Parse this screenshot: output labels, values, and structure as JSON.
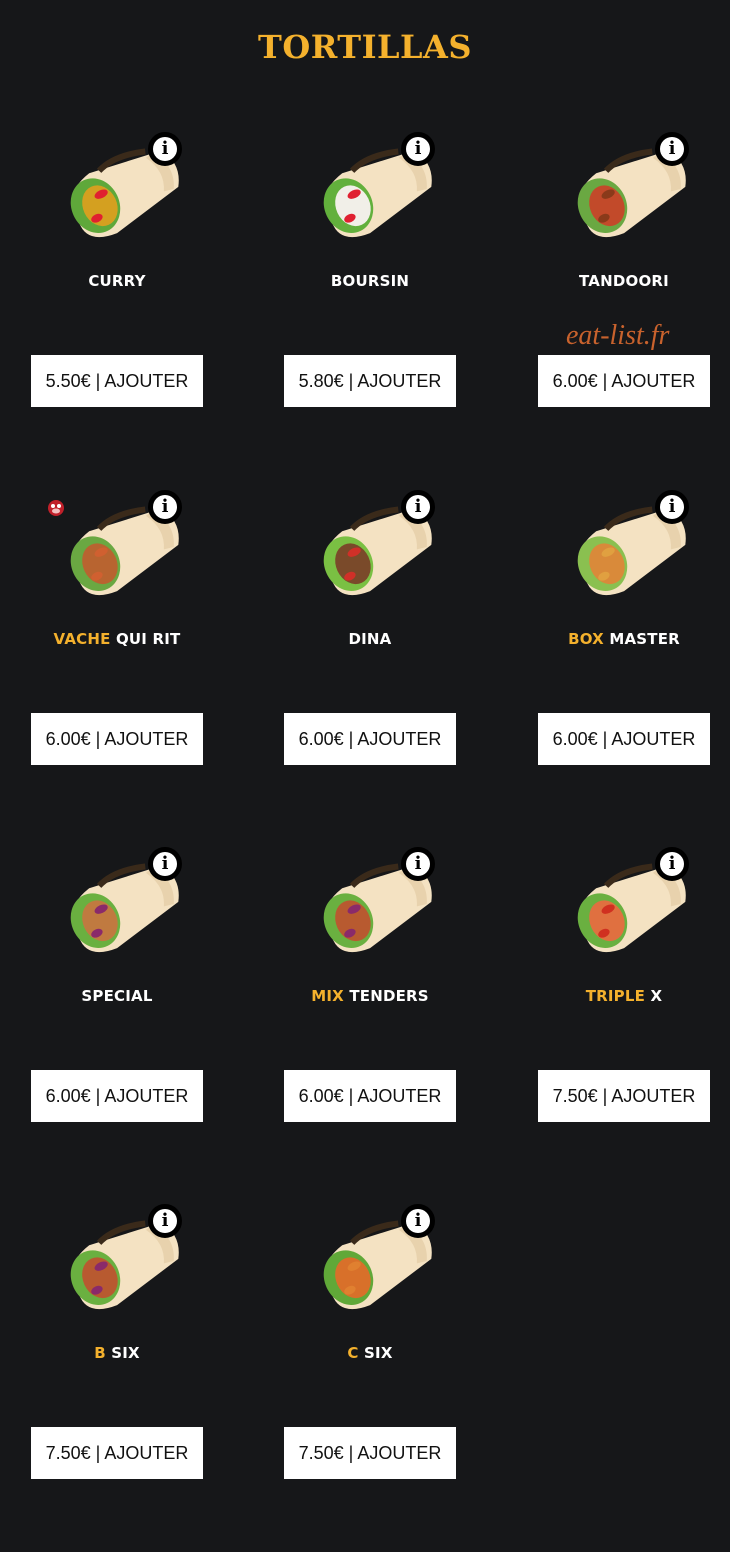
{
  "title": "TORTILLAS",
  "watermark": "eat-list.fr",
  "info_glyph": "i",
  "items": [
    {
      "accent": "",
      "name": "CURRY",
      "button": "5.50€ | AJOUTER",
      "filling": "curry"
    },
    {
      "accent": "",
      "name": "BOURSIN",
      "button": "5.80€ | AJOUTER",
      "filling": "boursin"
    },
    {
      "accent": "",
      "name": "TANDOORI",
      "button": "6.00€ | AJOUTER",
      "filling": "tandoori"
    },
    {
      "accent": "VACHE",
      "name": " QUI RIT",
      "button": "6.00€ | AJOUTER",
      "filling": "meat"
    },
    {
      "accent": "",
      "name": "DINA",
      "button": "6.00€ | AJOUTER",
      "filling": "dina"
    },
    {
      "accent": "BOX",
      "name": " MASTER",
      "button": "6.00€ | AJOUTER",
      "filling": "chicken"
    },
    {
      "accent": "",
      "name": "SPECIAL",
      "button": "6.00€ | AJOUTER",
      "filling": "special"
    },
    {
      "accent": "MIX",
      "name": " TENDERS",
      "button": "6.00€ | AJOUTER",
      "filling": "mix"
    },
    {
      "accent": "TRIPLE",
      "name": " X",
      "button": "7.50€ | AJOUTER",
      "filling": "triple"
    },
    {
      "accent": "B",
      "name": " SIX",
      "button": "7.50€ | AJOUTER",
      "filling": "mix"
    },
    {
      "accent": "C",
      "name": " SIX",
      "button": "7.50€ | AJOUTER",
      "filling": "crispy"
    }
  ],
  "colors": {
    "background": "#161719",
    "accent": "#f4b12d",
    "watermark": "#c8622d"
  }
}
